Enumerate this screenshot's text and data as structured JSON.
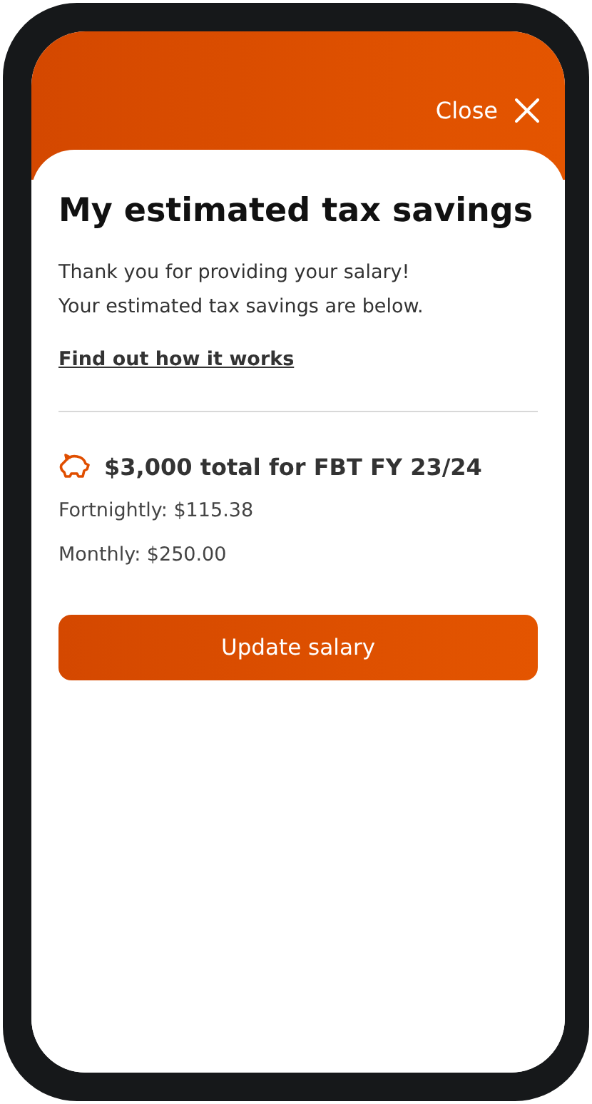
{
  "header": {
    "close_label": "Close"
  },
  "card": {
    "title": "My estimated tax savings",
    "intro": [
      "Thank you for providing your salary!",
      "Your estimated tax savings are below."
    ],
    "link": "Find out how it works",
    "total": "$3,000 total for FBT FY 23/24",
    "breakdown": [
      "Fortnightly: $115.38",
      "Monthly: $250.00"
    ],
    "button": "Update salary"
  }
}
